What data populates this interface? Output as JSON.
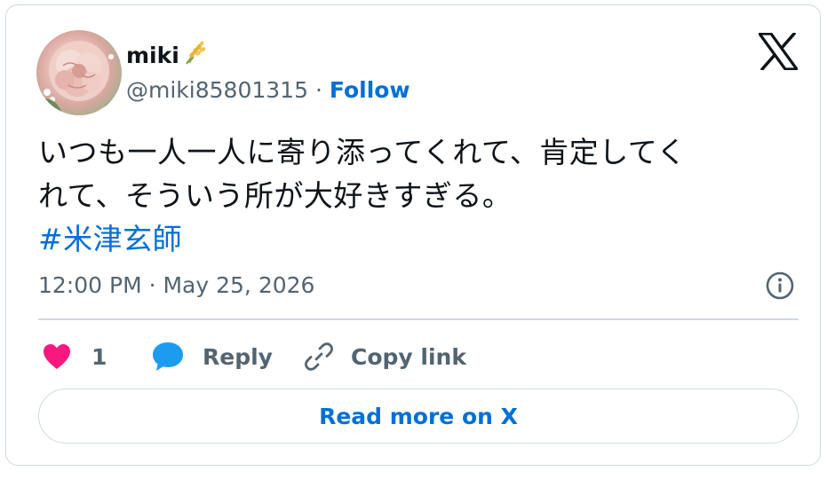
{
  "author": {
    "name": "miki",
    "name_emoji_icon": "rice-ear-icon",
    "handle": "@miki85801315",
    "separator": "·",
    "follow_label": "Follow",
    "avatar_icon": "flower-photo-avatar"
  },
  "tweet": {
    "text_line1": "いつも一人一人に寄り添ってくれて、肯定してく",
    "text_line2": "れて、そういう所が大好きすぎる。",
    "hashtag": "#米津玄師",
    "timestamp": "12:00 PM · May 25, 2026"
  },
  "actions": {
    "like_count": "1",
    "reply_label": "Reply",
    "copy_link_label": "Copy link"
  },
  "footer": {
    "read_more_label": "Read more on X"
  },
  "colors": {
    "accent": "#006fd6",
    "like": "#f91880",
    "reply_bubble": "#1d9bf0",
    "text": "#0f1419",
    "muted": "#536471",
    "border": "#cfd9de"
  }
}
